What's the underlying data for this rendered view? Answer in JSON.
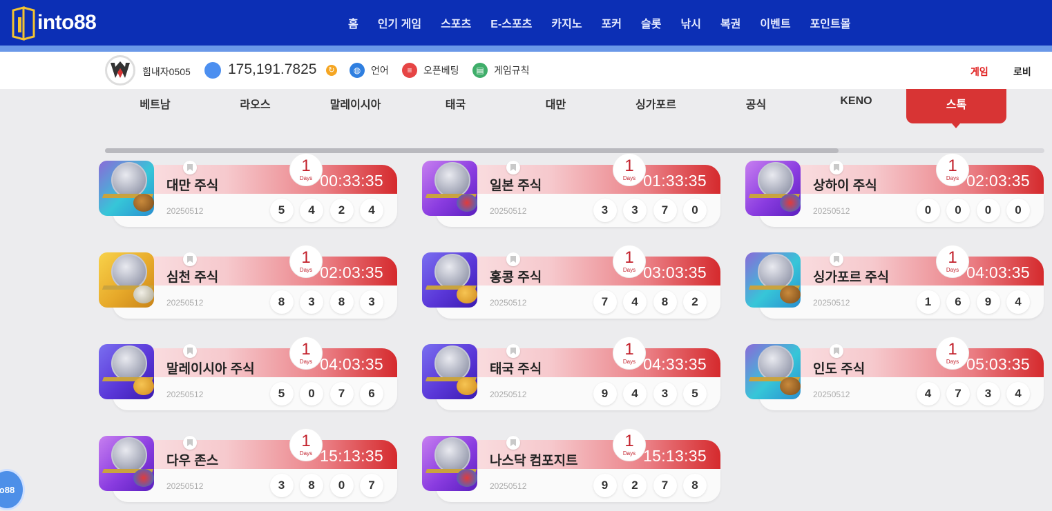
{
  "logo": {
    "text": "into88"
  },
  "nav": [
    "홈",
    "인기 게임",
    "스포츠",
    "E-스포츠",
    "카지노",
    "포커",
    "슬롯",
    "낚시",
    "복권",
    "이벤트",
    "포인트몰"
  ],
  "user": {
    "name": "힘내자0505",
    "balance": "175,191.7825",
    "links": {
      "language": "언어",
      "open_betting": "오픈베팅",
      "game_rules": "게임규칙"
    },
    "right_links": {
      "game": "게임",
      "lobby": "로비"
    }
  },
  "tabs": [
    "베트남",
    "라오스",
    "말레이시아",
    "태국",
    "대만",
    "싱가포르",
    "공식",
    "KENO",
    "스톡"
  ],
  "active_tab": "스톡",
  "cards": [
    {
      "title": "대만 주식",
      "days": "1",
      "days_label": "Days",
      "timer": "00:33:35",
      "date": "20250512",
      "numbers": [
        "5",
        "4",
        "2",
        "4"
      ],
      "theme": "teal-coins"
    },
    {
      "title": "일본 주식",
      "days": "1",
      "days_label": "Days",
      "timer": "01:33:35",
      "date": "20250512",
      "numbers": [
        "3",
        "3",
        "7",
        "0"
      ],
      "theme": "purple-chips"
    },
    {
      "title": "상하이 주식",
      "days": "1",
      "days_label": "Days",
      "timer": "02:03:35",
      "date": "20250512",
      "numbers": [
        "0",
        "0",
        "0",
        "0"
      ],
      "theme": "purple-chips"
    },
    {
      "title": "심천 주식",
      "days": "1",
      "days_label": "Days",
      "timer": "02:03:35",
      "date": "20250512",
      "numbers": [
        "8",
        "3",
        "8",
        "3"
      ],
      "theme": "gold-bag"
    },
    {
      "title": "홍콩 주식",
      "days": "1",
      "days_label": "Days",
      "timer": "03:03:35",
      "date": "20250512",
      "numbers": [
        "7",
        "4",
        "8",
        "2"
      ],
      "theme": "violet-arrow"
    },
    {
      "title": "싱가포르 주식",
      "days": "1",
      "days_label": "Days",
      "timer": "04:03:35",
      "date": "20250512",
      "numbers": [
        "1",
        "6",
        "9",
        "4"
      ],
      "theme": "teal-coins"
    },
    {
      "title": "말레이시아 주식",
      "days": "1",
      "days_label": "Days",
      "timer": "04:03:35",
      "date": "20250512",
      "numbers": [
        "5",
        "0",
        "7",
        "6"
      ],
      "theme": "violet-arrow"
    },
    {
      "title": "태국 주식",
      "days": "1",
      "days_label": "Days",
      "timer": "04:33:35",
      "date": "20250512",
      "numbers": [
        "9",
        "4",
        "3",
        "5"
      ],
      "theme": "violet-arrow"
    },
    {
      "title": "인도 주식",
      "days": "1",
      "days_label": "Days",
      "timer": "05:03:35",
      "date": "20250512",
      "numbers": [
        "4",
        "7",
        "3",
        "4"
      ],
      "theme": "teal-coins"
    },
    {
      "title": "다우 존스",
      "days": "1",
      "days_label": "Days",
      "timer": "15:13:35",
      "date": "20250512",
      "numbers": [
        "3",
        "8",
        "0",
        "7"
      ],
      "theme": "purple-chips"
    },
    {
      "title": "나스닥 컴포지트",
      "days": "1",
      "days_label": "Days",
      "timer": "15:13:35",
      "date": "20250512",
      "numbers": [
        "9",
        "2",
        "7",
        "8"
      ],
      "theme": "purple-chips"
    }
  ],
  "floating_button": "o88",
  "colors": {
    "header": "#0c2fb5",
    "accent": "#d83434",
    "timer_text": "#ffffff"
  }
}
